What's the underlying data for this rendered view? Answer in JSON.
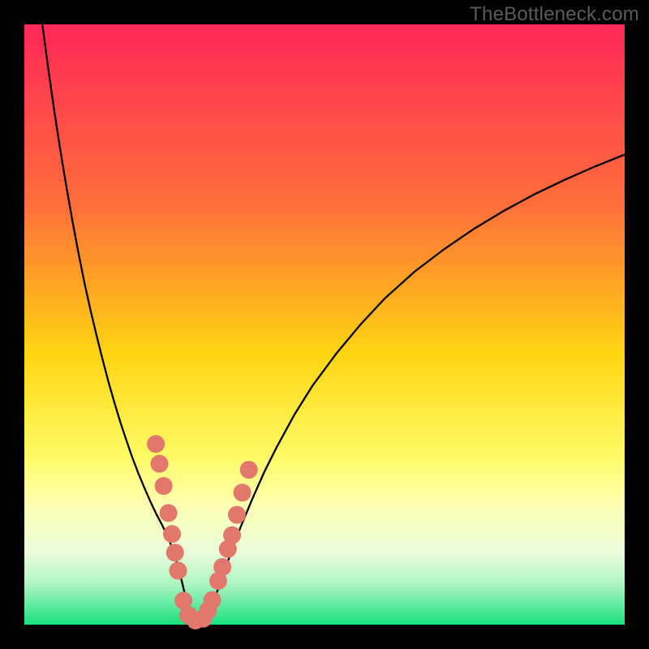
{
  "watermark": "TheBottleneck.com",
  "chart_data": {
    "type": "line",
    "title": "",
    "xlabel": "",
    "ylabel": "",
    "xlim": [
      0,
      100
    ],
    "ylim": [
      0,
      100
    ],
    "grid": false,
    "legend": false,
    "background_gradient": {
      "stops": [
        {
          "offset": 0.0,
          "color": "#ff2757"
        },
        {
          "offset": 0.3,
          "color": "#ff6e3a"
        },
        {
          "offset": 0.55,
          "color": "#ffd511"
        },
        {
          "offset": 0.72,
          "color": "#fffb66"
        },
        {
          "offset": 0.8,
          "color": "#fdffb1"
        },
        {
          "offset": 0.88,
          "color": "#eafcdc"
        },
        {
          "offset": 0.93,
          "color": "#b1f5c2"
        },
        {
          "offset": 0.97,
          "color": "#5deaa0"
        },
        {
          "offset": 1.0,
          "color": "#16e07b"
        }
      ]
    },
    "series": [
      {
        "name": "bottleneck-curve",
        "color": "#000000",
        "x": [
          3,
          4,
          5,
          6,
          7,
          8,
          9,
          10,
          11,
          12,
          13,
          14,
          15,
          16,
          17,
          18,
          19,
          20,
          21,
          22,
          23,
          24,
          25,
          26,
          27,
          28,
          30,
          32,
          34,
          36,
          38,
          40,
          42,
          45,
          48,
          52,
          56,
          60,
          65,
          70,
          75,
          80,
          85,
          90,
          95,
          100
        ],
        "y": [
          100,
          92.5,
          85.5,
          79,
          73,
          67.3,
          62,
          57,
          52.5,
          48.3,
          44.3,
          40.5,
          37,
          33.7,
          30.7,
          27.8,
          25.2,
          22.8,
          20.5,
          18.4,
          16.5,
          14.4,
          11.8,
          8.2,
          4.0,
          1.3,
          0.5,
          5.2,
          10.8,
          16.2,
          21.0,
          25.5,
          29.5,
          35.0,
          39.8,
          45.2,
          50.0,
          54.3,
          58.8,
          62.6,
          66.0,
          69.0,
          71.7,
          74.1,
          76.3,
          78.3
        ]
      }
    ],
    "markers": {
      "name": "highlight-dots",
      "color": "#e2776c",
      "radius": 11,
      "points": [
        {
          "x": 21.9,
          "y": 30.1
        },
        {
          "x": 22.5,
          "y": 26.8
        },
        {
          "x": 23.2,
          "y": 23.1
        },
        {
          "x": 24.0,
          "y": 18.6
        },
        {
          "x": 24.6,
          "y": 15.1
        },
        {
          "x": 25.1,
          "y": 12.0
        },
        {
          "x": 25.6,
          "y": 9.0
        },
        {
          "x": 26.5,
          "y": 4.0
        },
        {
          "x": 27.3,
          "y": 1.6
        },
        {
          "x": 28.5,
          "y": 0.7
        },
        {
          "x": 29.8,
          "y": 1.0
        },
        {
          "x": 30.6,
          "y": 2.4
        },
        {
          "x": 31.3,
          "y": 4.1
        },
        {
          "x": 32.3,
          "y": 7.3
        },
        {
          "x": 33.0,
          "y": 9.6
        },
        {
          "x": 33.9,
          "y": 12.6
        },
        {
          "x": 34.6,
          "y": 14.9
        },
        {
          "x": 35.4,
          "y": 18.3
        },
        {
          "x": 36.3,
          "y": 22.0
        },
        {
          "x": 37.4,
          "y": 25.8
        }
      ]
    }
  }
}
